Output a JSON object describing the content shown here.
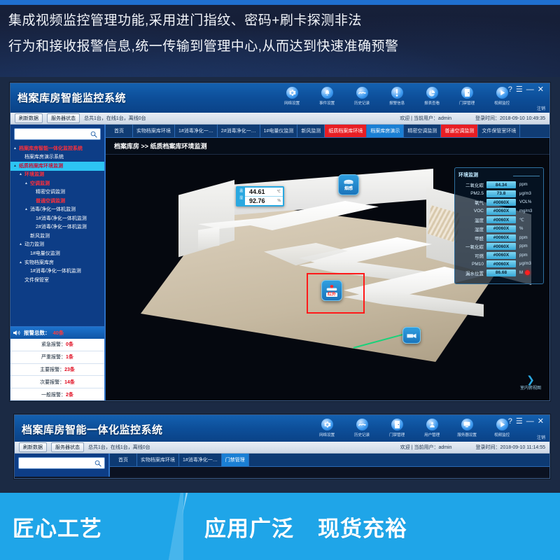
{
  "promo": {
    "line1": "集成视频监控管理功能,采用进门指纹、密码+刷卡探测非法",
    "line2": "行为和接收报警信息,统一传输到管理中心,从而达到快速准确预警"
  },
  "window1": {
    "title": "档案库房智能监控系统",
    "toolbar": [
      {
        "label": "网络设置",
        "icon": "gear-icon"
      },
      {
        "label": "事件设置",
        "icon": "bell-icon"
      },
      {
        "label": "历史记录",
        "icon": "wave-icon"
      },
      {
        "label": "报警信息",
        "icon": "alert-icon"
      },
      {
        "label": "报表查看",
        "icon": "pie-icon"
      },
      {
        "label": "门禁管理",
        "icon": "door-icon"
      },
      {
        "label": "视频监控",
        "icon": "play-icon"
      }
    ],
    "logout_label": "注销",
    "window_buttons": [
      "?",
      "☰",
      "—",
      "✕"
    ],
    "subbar": {
      "refresh_label": "刷新数据",
      "server_status_label": "服务器状态",
      "stat": "总共1台，在线1台，离线0台",
      "welcome": "欢迎 | 当前用户：admin",
      "login_time": "登录时间：2018-09-10 10:49:35"
    },
    "sidebar": {
      "search_placeholder": "",
      "search_value": "",
      "tree": [
        {
          "label": "档案库房智能一体化监控系统",
          "indent": 0,
          "caret": "▲",
          "style": "red"
        },
        {
          "label": "档案库房演示系统",
          "indent": 1,
          "caret": "",
          "style": "white"
        },
        {
          "label": "纸质档案库环境监测",
          "indent": 0,
          "caret": "▲",
          "style": "sel"
        },
        {
          "label": "环境监测",
          "indent": 1,
          "caret": "▲",
          "style": "red"
        },
        {
          "label": "空调监测",
          "indent": 2,
          "caret": "▲",
          "style": "red"
        },
        {
          "label": "精密空调监测",
          "indent": 3,
          "caret": "",
          "style": "white"
        },
        {
          "label": "普通空调监测",
          "indent": 3,
          "caret": "",
          "style": "red"
        },
        {
          "label": "消毒/净化一体机监测",
          "indent": 2,
          "caret": "▲",
          "style": "white"
        },
        {
          "label": "1#消毒/净化一体机监测",
          "indent": 3,
          "caret": "",
          "style": "white"
        },
        {
          "label": "2#消毒/净化一体机监测",
          "indent": 3,
          "caret": "",
          "style": "white"
        },
        {
          "label": "新风监测",
          "indent": 2,
          "caret": "",
          "style": "white"
        },
        {
          "label": "动力监测",
          "indent": 1,
          "caret": "▲",
          "style": "white"
        },
        {
          "label": "1#电量仪监测",
          "indent": 2,
          "caret": "",
          "style": "white"
        },
        {
          "label": "实物档案库房",
          "indent": 1,
          "caret": "▲",
          "style": "white"
        },
        {
          "label": "1#消毒/净化一体机监测",
          "indent": 2,
          "caret": "",
          "style": "white"
        },
        {
          "label": "文件保管室",
          "indent": 1,
          "caret": "",
          "style": "white"
        }
      ],
      "alarm": {
        "header_label": "报警总数：",
        "header_count": "40条",
        "rows": [
          {
            "label": "紧急报警：",
            "count": "0条"
          },
          {
            "label": "严重报警：",
            "count": "1条"
          },
          {
            "label": "主要报警：",
            "count": "23条"
          },
          {
            "label": "次要报警：",
            "count": "14条"
          },
          {
            "label": "一般报警：",
            "count": "2条"
          }
        ]
      }
    },
    "tabs": [
      {
        "label": "首页",
        "state": "home"
      },
      {
        "label": "实物档案库环境",
        "state": "normal"
      },
      {
        "label": "1#消毒净化一…",
        "state": "normal"
      },
      {
        "label": "2#消毒净化一…",
        "state": "normal"
      },
      {
        "label": "1#电量仪监测",
        "state": "normal"
      },
      {
        "label": "新风监测",
        "state": "normal"
      },
      {
        "label": "纸质档案库环境",
        "state": "red"
      },
      {
        "label": "档案库房演示",
        "state": "blue"
      },
      {
        "label": "精密空调监测",
        "state": "normal"
      },
      {
        "label": "普通空调监测",
        "state": "red"
      },
      {
        "label": "文件保管室环境",
        "state": "normal"
      }
    ],
    "breadcrumb": "档案库房 >> 纸质档案库环境监测",
    "scene": {
      "sensor_tooltip": {
        "tick_top": "温",
        "tick_bottom": "湿",
        "temperature": "44.61",
        "temperature_unit": "℃",
        "humidity": "92.76",
        "humidity_unit": "%"
      },
      "chips": [
        {
          "name": "烟感",
          "icon": "smoke-detector-icon"
        },
        {
          "name": "红外",
          "icon": "infrared-sensor-icon"
        },
        {
          "name": "",
          "icon": "camera-icon"
        }
      ]
    },
    "env_panel": {
      "title": "环境监测",
      "rows": [
        {
          "key": "二氧化碳",
          "value": "84.34",
          "unit": "ppm",
          "alarm": false
        },
        {
          "key": "PM2.5",
          "value": "73.8",
          "unit": "μg/m3",
          "alarm": false
        },
        {
          "key": "氧气",
          "value": "#0060X",
          "unit": "VOL%",
          "alarm": false
        },
        {
          "key": "VOC",
          "value": "#0060X",
          "unit": "mg/m3",
          "alarm": false
        },
        {
          "key": "温度",
          "value": "#0060X",
          "unit": "℃",
          "alarm": false
        },
        {
          "key": "湿度",
          "value": "#0060X",
          "unit": "%",
          "alarm": false
        },
        {
          "key": "甲醛",
          "value": "#0060X",
          "unit": "ppm",
          "alarm": false
        },
        {
          "key": "一氧化碳",
          "value": "#0060X",
          "unit": "ppm",
          "alarm": false
        },
        {
          "key": "可燃",
          "value": "#0060X",
          "unit": "ppm",
          "alarm": false
        },
        {
          "key": "PM10",
          "value": "#0060X",
          "unit": "μg/m3",
          "alarm": false
        },
        {
          "key": "漏水位置",
          "value": "86.68",
          "unit": "M",
          "alarm": true
        }
      ],
      "footer_label": "室内俯视图",
      "footer_arrow": "❯"
    }
  },
  "window2": {
    "title": "档案库房智能一体化监控系统",
    "toolbar": [
      {
        "label": "网络设置",
        "icon": "gear-icon"
      },
      {
        "label": "历史记录",
        "icon": "wave-icon"
      },
      {
        "label": "门禁管理",
        "icon": "door-icon"
      },
      {
        "label": "用户管理",
        "icon": "user-icon"
      },
      {
        "label": "服务器设置",
        "icon": "server-icon"
      },
      {
        "label": "视频监控",
        "icon": "play-icon"
      }
    ],
    "logout_label": "注销",
    "window_buttons": [
      "?",
      "☰",
      "—",
      "✕"
    ],
    "subbar": {
      "refresh_label": "刷新数据",
      "server_status_label": "服务器状态",
      "stat": "总共1台，在线1台，离线0台",
      "welcome": "欢迎 | 当前用户：admin",
      "login_time": "登录时间：2018-09-10 11:14:55"
    },
    "search_value": "",
    "tabs": [
      {
        "label": "首页",
        "state": "home"
      },
      {
        "label": "实物档案库环境",
        "state": "normal"
      },
      {
        "label": "1#消毒净化一…",
        "state": "normal"
      },
      {
        "label": "门禁管理",
        "state": "blue"
      }
    ]
  },
  "bottom_banner": {
    "left_slogan": "匠心工艺",
    "right_slogans": [
      "应用广泛",
      "现货充裕"
    ],
    "color": "#1fa5e8"
  },
  "colors": {
    "accent_blue": "#1fa5e8",
    "alarm_red": "#e81e24",
    "title_blue": "#0d4f9a",
    "sidebar_blue": "#0d3d86",
    "selected_cyan": "#2dc4f3"
  }
}
